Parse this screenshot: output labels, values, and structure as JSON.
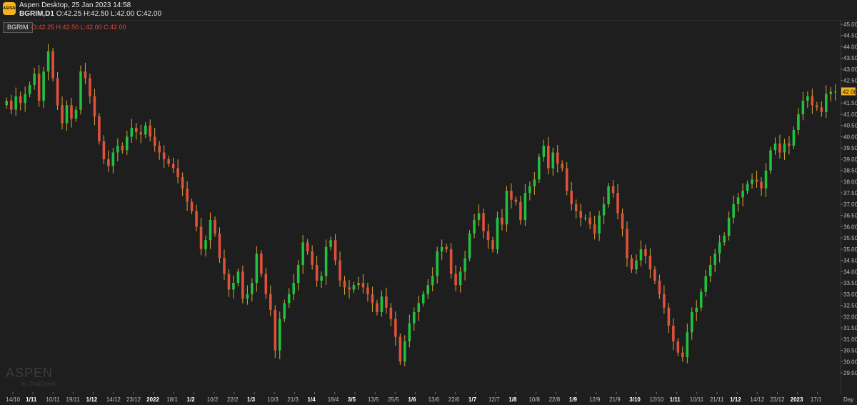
{
  "app": {
    "title": "Aspen Desktop, 25 Jan 2023 14:58",
    "symbol_line_symbol": "BGRIM,D1",
    "symbol_line_ohlc": "O:42.25 H:42.50 L:42.00 C:42.00",
    "logo_text": "ASPEN"
  },
  "chart_header": {
    "symbol": "BGRIM",
    "ohlc": "O:42.25 H:42.50 L:42.00 C:42.00"
  },
  "watermark": {
    "brand": "ASPEN",
    "sub": "by ThaiQuest"
  },
  "colors": {
    "up": "#1fc23f",
    "down": "#e0513c",
    "wick": "#d8a53a",
    "last_price": "#f2b31d"
  },
  "chart_data": {
    "type": "candlestick",
    "timeframe": "Day",
    "ylim": [
      29.5,
      45.0
    ],
    "y_ticks": [
      "45.00",
      "44.50",
      "44.00",
      "43.50",
      "43.00",
      "42.50",
      "42.00",
      "41.50",
      "41.00",
      "40.50",
      "40.00",
      "39.50",
      "39.00",
      "38.50",
      "38.00",
      "37.50",
      "37.00",
      "36.50",
      "36.00",
      "35.50",
      "35.00",
      "34.50",
      "34.00",
      "33.50",
      "33.00",
      "32.50",
      "32.00",
      "31.50",
      "31.00",
      "30.50",
      "30.00",
      "29.50"
    ],
    "last_price": "42.00",
    "x_labels": [
      {
        "t": "14/10",
        "b": false
      },
      {
        "t": "1/11",
        "b": true
      },
      {
        "t": "10/11",
        "b": false
      },
      {
        "t": "19/11",
        "b": false
      },
      {
        "t": "1/12",
        "b": true
      },
      {
        "t": "14/12",
        "b": false
      },
      {
        "t": "23/12",
        "b": false
      },
      {
        "t": "2022",
        "b": true
      },
      {
        "t": "18/1",
        "b": false
      },
      {
        "t": "1/2",
        "b": true
      },
      {
        "t": "10/2",
        "b": false
      },
      {
        "t": "22/2",
        "b": false
      },
      {
        "t": "1/3",
        "b": true
      },
      {
        "t": "10/3",
        "b": false
      },
      {
        "t": "21/3",
        "b": false
      },
      {
        "t": "1/4",
        "b": true
      },
      {
        "t": "18/4",
        "b": false
      },
      {
        "t": "3/5",
        "b": true
      },
      {
        "t": "13/5",
        "b": false
      },
      {
        "t": "25/5",
        "b": false
      },
      {
        "t": "1/6",
        "b": true
      },
      {
        "t": "13/6",
        "b": false
      },
      {
        "t": "22/6",
        "b": false
      },
      {
        "t": "1/7",
        "b": true
      },
      {
        "t": "12/7",
        "b": false
      },
      {
        "t": "1/8",
        "b": true
      },
      {
        "t": "10/8",
        "b": false
      },
      {
        "t": "22/8",
        "b": false
      },
      {
        "t": "1/9",
        "b": true
      },
      {
        "t": "12/9",
        "b": false
      },
      {
        "t": "21/9",
        "b": false
      },
      {
        "t": "3/10",
        "b": true
      },
      {
        "t": "12/10",
        "b": false
      },
      {
        "t": "1/11",
        "b": true
      },
      {
        "t": "10/11",
        "b": false
      },
      {
        "t": "21/11",
        "b": false
      },
      {
        "t": "1/12",
        "b": true
      },
      {
        "t": "14/12",
        "b": false
      },
      {
        "t": "23/12",
        "b": false
      },
      {
        "t": "2023",
        "b": true
      },
      {
        "t": "17/1",
        "b": false
      }
    ],
    "x_axis_unit": "Day",
    "closes": [
      41.6,
      41.2,
      41.8,
      41.5,
      41.9,
      42.3,
      42.8,
      41.6,
      42.9,
      43.8,
      42.6,
      41.4,
      40.6,
      41.4,
      40.8,
      41.2,
      42.9,
      42.6,
      41.8,
      40.9,
      39.8,
      39.0,
      38.7,
      39.3,
      39.6,
      39.4,
      40.0,
      40.4,
      40.2,
      40.1,
      40.5,
      40.0,
      39.6,
      39.3,
      39.0,
      38.8,
      38.6,
      38.2,
      37.7,
      37.1,
      36.7,
      36.0,
      35.0,
      35.4,
      36.3,
      35.7,
      34.6,
      33.9,
      33.2,
      33.5,
      34.0,
      32.8,
      33.0,
      33.5,
      34.8,
      33.9,
      33.0,
      32.3,
      30.5,
      31.9,
      32.6,
      33.0,
      33.5,
      34.3,
      35.3,
      34.9,
      34.3,
      33.6,
      33.8,
      35.1,
      35.4,
      34.5,
      33.6,
      33.3,
      33.2,
      33.4,
      33.5,
      33.3,
      33.0,
      32.6,
      32.2,
      32.9,
      32.4,
      31.9,
      31.1,
      30.0,
      30.9,
      31.7,
      32.2,
      32.6,
      33.0,
      33.4,
      33.8,
      34.9,
      35.1,
      35.0,
      33.9,
      33.4,
      34.0,
      34.6,
      35.7,
      36.3,
      36.6,
      35.8,
      35.4,
      35.0,
      36.4,
      36.1,
      37.6,
      37.2,
      37.1,
      36.3,
      37.5,
      37.8,
      38.1,
      39.1,
      39.6,
      38.6,
      39.3,
      38.8,
      38.6,
      37.6,
      37.0,
      36.7,
      36.4,
      36.4,
      36.1,
      35.7,
      36.5,
      37.0,
      37.8,
      37.5,
      36.6,
      35.9,
      34.6,
      34.1,
      34.5,
      35.0,
      34.7,
      34.1,
      33.6,
      33.0,
      32.4,
      31.6,
      30.9,
      30.4,
      30.2,
      31.3,
      32.2,
      32.4,
      33.1,
      33.8,
      34.3,
      34.8,
      35.3,
      35.6,
      36.4,
      37.0,
      37.3,
      37.6,
      37.9,
      38.1,
      38.0,
      37.7,
      38.5,
      39.4,
      39.7,
      39.3,
      39.7,
      39.6,
      40.3,
      41.0,
      41.6,
      41.8,
      41.4,
      41.3,
      41.1,
      41.9,
      42.0,
      42.0
    ],
    "note": "Close values estimated from the chart; each candle's open is the previous close."
  }
}
